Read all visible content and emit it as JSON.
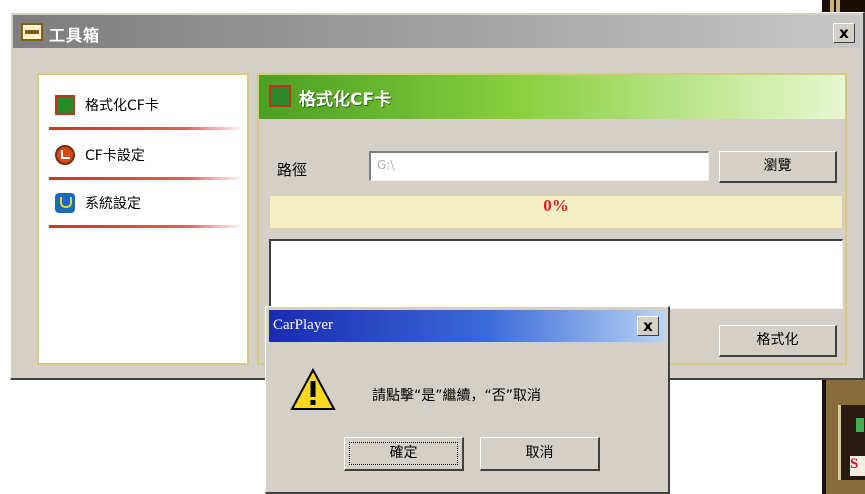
{
  "toolbox": {
    "title": "工具箱",
    "close_label": "x",
    "nav": {
      "items": [
        {
          "label": "格式化CF卡",
          "icon": "format-card-icon"
        },
        {
          "label": "CF卡設定",
          "icon": "cf-settings-icon"
        },
        {
          "label": "系統設定",
          "icon": "system-settings-icon"
        }
      ]
    },
    "panel": {
      "title": "格式化CF卡",
      "path_label": "路徑",
      "path_value": "G:\\",
      "browse_label": "瀏覽",
      "progress_text": "0%",
      "progress_value": 0,
      "format_label": "格式化"
    }
  },
  "dialog": {
    "title": "CarPlayer",
    "close_label": "x",
    "message": "請點擊“是”繼續，“否”取消",
    "ok_label": "確定",
    "cancel_label": "取消",
    "icon": "warning-icon"
  },
  "background_window": {
    "label": "S"
  },
  "colors": {
    "accent_green": "#4aa020",
    "nav_underline": "#d03030",
    "progress_text": "#e02020",
    "dialog_title_blue": "#1a2ab0"
  }
}
